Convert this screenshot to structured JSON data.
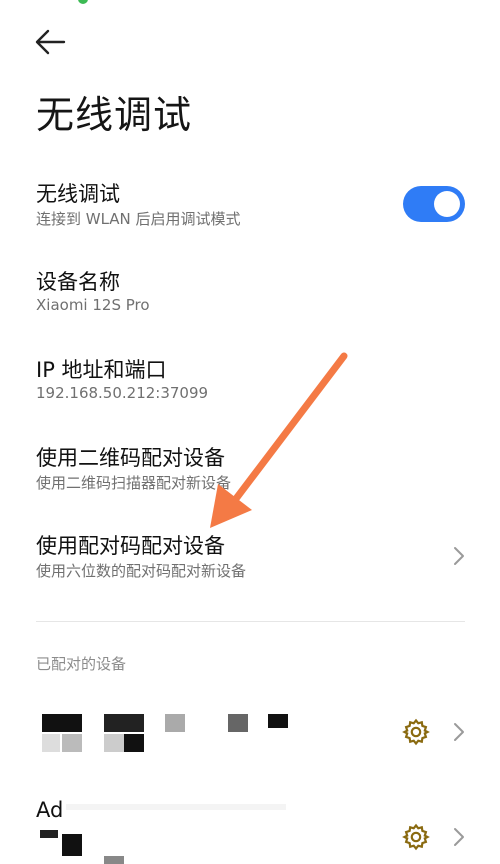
{
  "header": {
    "back_icon": "back-arrow-icon",
    "title": "无线调试"
  },
  "settings": {
    "wireless_debugging": {
      "title": "无线调试",
      "subtitle": "连接到 WLAN 后启用调试模式",
      "enabled": true
    },
    "device_name": {
      "title": "设备名称",
      "value": "Xiaomi 12S Pro"
    },
    "ip_port": {
      "title": "IP 地址和端口",
      "value": "192.168.50.212:37099"
    },
    "pair_qr": {
      "title": "使用二维码配对设备",
      "subtitle": "使用二维码扫描器配对新设备"
    },
    "pair_code": {
      "title": "使用配对码配对设备",
      "subtitle": "使用六位数的配对码配对新设备"
    }
  },
  "paired_devices": {
    "section_label": "已配对的设备",
    "items": [
      {
        "name": "",
        "settings_icon": "gear-icon",
        "chevron": "chevron-right-icon"
      },
      {
        "name": "Ad",
        "settings_icon": "gear-icon",
        "chevron": "chevron-right-icon"
      }
    ]
  },
  "colors": {
    "toggle_on": "#2f7cf6",
    "gear": "#8a6a10",
    "annotation_arrow": "#f47a45"
  }
}
